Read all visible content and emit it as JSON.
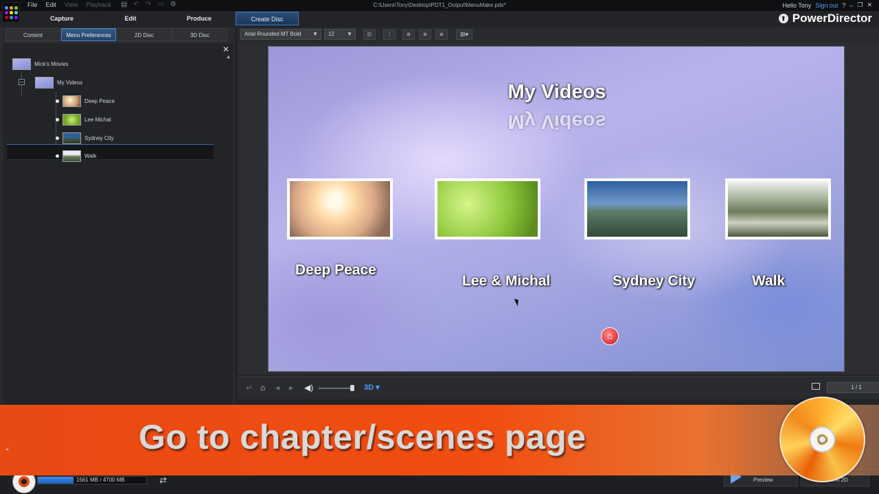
{
  "titlebar": {
    "menu": [
      {
        "label": "File",
        "enabled": true
      },
      {
        "label": "Edit",
        "enabled": true
      },
      {
        "label": "View",
        "enabled": false
      },
      {
        "label": "Playback",
        "enabled": false
      }
    ],
    "file_path": "C:\\Users\\Tony\\Desktop\\PDT1_Output\\MenuMake.pds*",
    "greeting": "Hello Tony",
    "sign_out": "Sign out",
    "help": "?"
  },
  "main_tabs": [
    {
      "label": "Capture",
      "active": false
    },
    {
      "label": "Edit",
      "active": false
    },
    {
      "label": "Produce",
      "active": false
    },
    {
      "label": "Create Disc",
      "active": true
    }
  ],
  "brand": "PowerDirector",
  "sub_tabs": [
    {
      "label": "Content",
      "active": false
    },
    {
      "label": "Menu Preferences",
      "active": true
    },
    {
      "label": "2D Disc",
      "active": false
    },
    {
      "label": "3D Disc",
      "active": false
    }
  ],
  "tree": {
    "root": "Mick's Movies",
    "folder": "My Videos",
    "items": [
      "Deep Peace",
      "Lee  Michal",
      "Sydney City",
      "Walk"
    ],
    "selected_index": 2
  },
  "format_toolbar": {
    "font": "Arial Rounded MT Bold",
    "size": "12",
    "bold": "B",
    "italic": "I"
  },
  "menu_preview": {
    "title": "My Videos",
    "chapters": [
      {
        "label": "Deep Peace"
      },
      {
        "label": "Lee & Michal"
      },
      {
        "label": "Sydney City"
      },
      {
        "label": "Walk"
      }
    ]
  },
  "playback": {
    "mode": "3D",
    "page": "1 / 1"
  },
  "bottom": {
    "capacity_text": "1561 MB / 4700 MB",
    "capacity_fraction": 0.33,
    "preview_label": "Preview",
    "burn_label": "Burn in 2D"
  },
  "caption": "Go to chapter/scenes page",
  "colors": {
    "accent": "#3f7bc2",
    "banner": "#f14d10",
    "link": "#4aa3ff"
  }
}
